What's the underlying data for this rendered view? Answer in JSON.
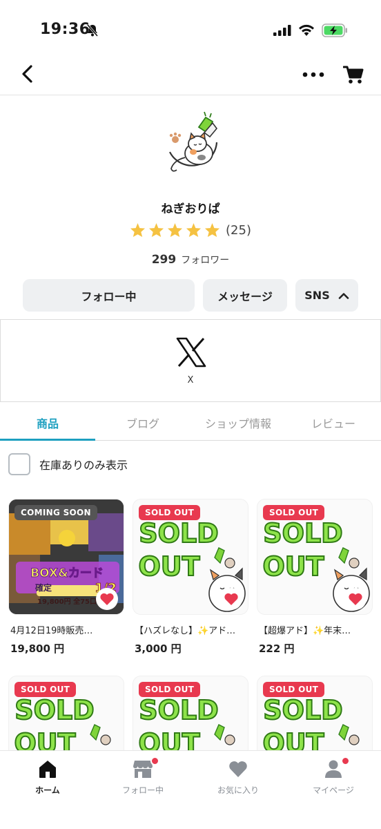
{
  "status_bar": {
    "time": "19:36"
  },
  "profile": {
    "shop_name": "ねぎおりぱ",
    "rating_stars": 5,
    "review_count": "(25)",
    "followers_count": "299",
    "followers_label": "フォロワー"
  },
  "actions": {
    "follow": "フォロー中",
    "message": "メッセージ",
    "sns": "SNS"
  },
  "sns": {
    "x_label": "X"
  },
  "tabs": [
    "商品",
    "ブログ",
    "ショップ情報",
    "レビュー"
  ],
  "filter": {
    "in_stock_label": "在庫ありのみ表示"
  },
  "products": [
    {
      "badge": "COMING SOON",
      "title": "4月12日19時販売…",
      "price": "19,800 円"
    },
    {
      "badge": "SOLD OUT",
      "title": "【ハズレなし】✨アド…",
      "price": "3,000 円"
    },
    {
      "badge": "SOLD OUT",
      "title": "【超爆アド】✨年末…",
      "price": "222 円"
    },
    {
      "badge": "SOLD OUT",
      "title": "",
      "price": ""
    },
    {
      "badge": "SOLD OUT",
      "title": "",
      "price": ""
    },
    {
      "badge": "SOLD OUT",
      "title": "",
      "price": ""
    }
  ],
  "sold_out_art": {
    "line1": "SOLD",
    "line2": "OUT"
  },
  "promo_image_text": {
    "headline": "BOX&カード",
    "sub": "確定",
    "price": "19,800円 全75口",
    "ratio": "1/2"
  },
  "bottom_nav": [
    "ホーム",
    "フォロー中",
    "お気に入り",
    "マイページ"
  ],
  "colors": {
    "accent": "#1ea0c0",
    "sold_badge": "#e8394f",
    "star": "#f5c242"
  }
}
